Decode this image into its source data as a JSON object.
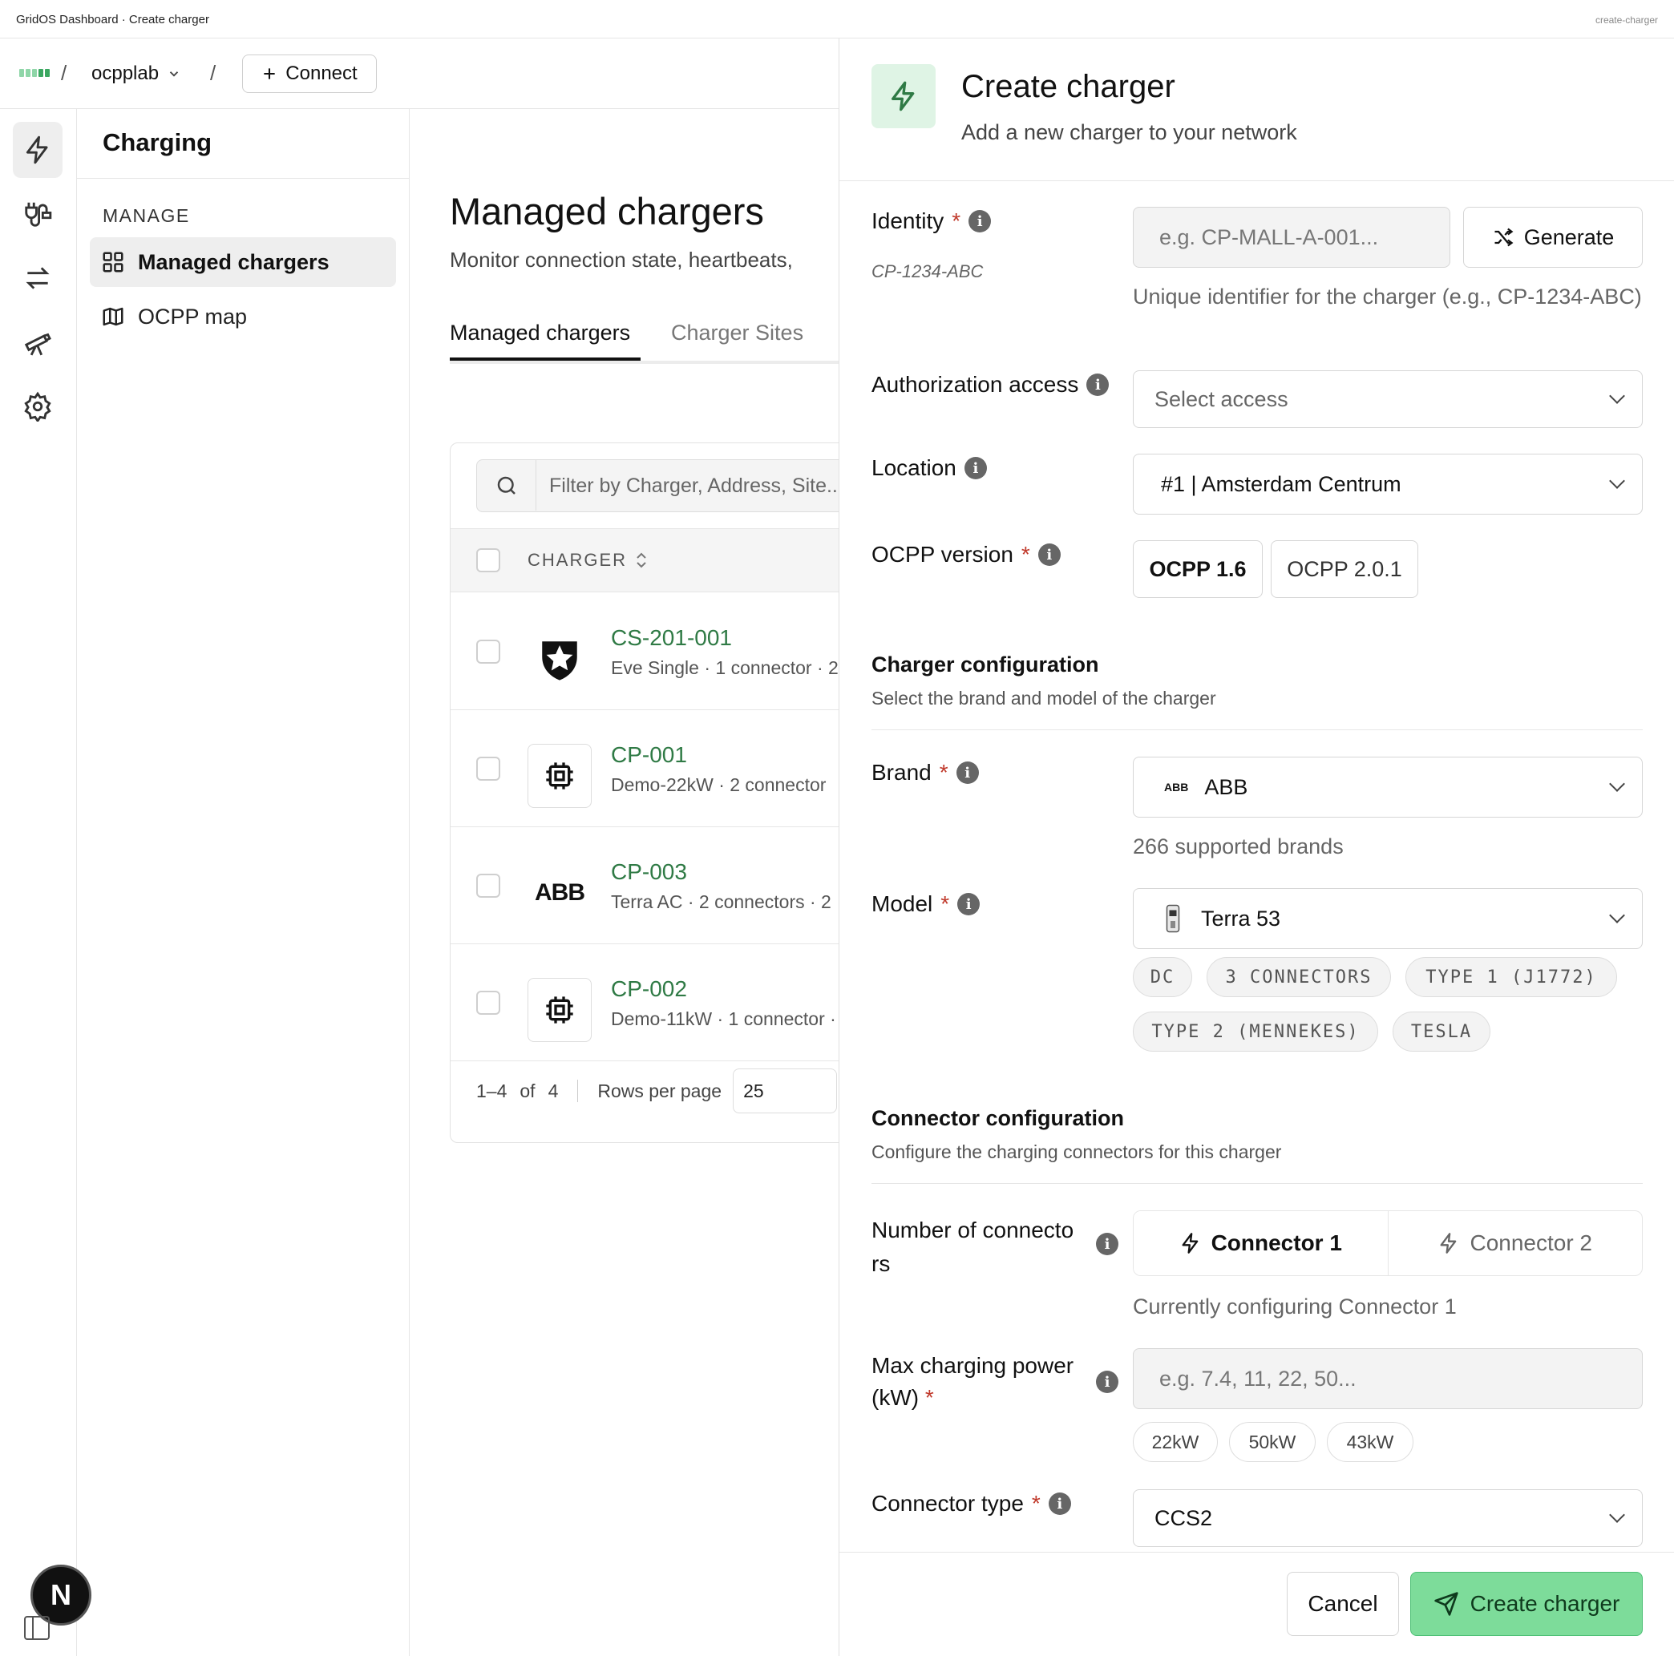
{
  "topbar": {
    "title": "GridOS Dashboard · Create charger",
    "route": "create-charger"
  },
  "workspace": {
    "name": "ocpplab",
    "connect_label": "Connect"
  },
  "sidenav": {
    "title": "Charging",
    "section": "MANAGE",
    "items": [
      {
        "label": "Managed chargers",
        "icon": "grid-icon",
        "active": true
      },
      {
        "label": "OCPP map",
        "icon": "map-icon",
        "active": false
      }
    ]
  },
  "main": {
    "title": "Managed chargers",
    "subtitle": "Monitor connection state, heartbeats,",
    "tabs": [
      {
        "label": "Managed chargers",
        "active": true
      },
      {
        "label": "Charger Sites",
        "active": false
      }
    ],
    "search_placeholder": "Filter by Charger, Address, Site...",
    "column_header": "CHARGER",
    "rows": [
      {
        "name": "CS-201-001",
        "meta": "Eve Single · 1 connector · 2",
        "icon": "star-shield-icon"
      },
      {
        "name": "CP-001",
        "meta": "Demo-22kW · 2 connector",
        "icon": "chip-icon"
      },
      {
        "name": "CP-003",
        "meta": "Terra AC · 2 connectors · 2",
        "icon": "abb-logo",
        "logo_text": "ABB"
      },
      {
        "name": "CP-002",
        "meta": "Demo-11kW · 1 connector ·",
        "icon": "chip-icon"
      }
    ],
    "pager": {
      "range": "1–4",
      "of": "of",
      "total": "4",
      "rows_label": "Rows per page",
      "rows_value": "25"
    }
  },
  "drawer": {
    "title": "Create charger",
    "subtitle": "Add a new charger to your network",
    "identity": {
      "label": "Identity",
      "example": "CP-1234-ABC",
      "placeholder": "e.g. CP-MALL-A-001...",
      "generate_label": "Generate",
      "helper": "Unique identifier for the charger (e.g., CP-1234-ABC)"
    },
    "auth": {
      "label": "Authorization access",
      "placeholder": "Select access"
    },
    "location": {
      "label": "Location",
      "value": "#1 | Amsterdam Centrum"
    },
    "ocpp": {
      "label": "OCPP version",
      "options": [
        "OCPP 1.6",
        "OCPP 2.0.1"
      ],
      "selected": "OCPP 1.6"
    },
    "charger_config": {
      "title": "Charger configuration",
      "subtitle": "Select the brand and model of the charger"
    },
    "brand": {
      "label": "Brand",
      "value": "ABB",
      "logo_text": "ABB",
      "helper": "266 supported brands"
    },
    "model": {
      "label": "Model",
      "value": "Terra 53",
      "tags": [
        "DC",
        "3 CONNECTORS",
        "TYPE 1 (J1772)",
        "TYPE 2 (MENNEKES)",
        "TESLA"
      ]
    },
    "connector_config": {
      "title": "Connector configuration",
      "subtitle": "Configure the charging connectors for this charger"
    },
    "num_connectors": {
      "label_line1": "Number of connecto",
      "label_line2": "rs",
      "tabs": [
        "Connector 1",
        "Connector 2"
      ],
      "helper": "Currently configuring Connector 1"
    },
    "max_power": {
      "label_line1": "Max charging power",
      "label_line2": "(kW)",
      "placeholder": "e.g. 7.4, 11, 22, 50...",
      "presets": [
        "22kW",
        "50kW",
        "43kW"
      ]
    },
    "connector_type": {
      "label": "Connector type",
      "value": "CCS2"
    },
    "cancel_label": "Cancel",
    "submit_label": "Create charger"
  },
  "colors": {
    "accent": "#2f7a45",
    "accent_light": "#7ddc9a",
    "icon_bg": "#dff4e5",
    "required": "#c0392b"
  }
}
